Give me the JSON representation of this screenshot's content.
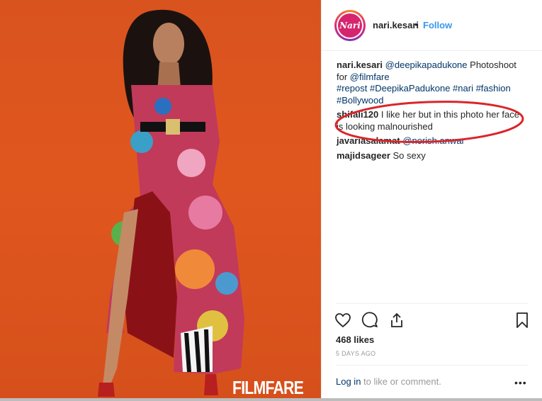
{
  "post": {
    "username": "nari.kesari",
    "avatar_text": "Nari",
    "dot": "•",
    "follow_label": "Follow",
    "watermark": "FILMFARE"
  },
  "caption": {
    "username": "nari.kesari",
    "mention": "@deepikapadukone",
    "text1": " Photoshoot for ",
    "mention2": "@filmfare",
    "hashtags": "#repost #DeepikaPadukone #nari #fashion #Bollywood"
  },
  "comments": [
    {
      "user": "shifali120",
      "text": "I like her but in this photo her face is looking malnourished"
    },
    {
      "user": "javariasalamat",
      "text": "@norish.anwar"
    },
    {
      "user": "majidsageer",
      "text": "So sexy"
    }
  ],
  "stats": {
    "likes": "468 likes",
    "timestamp": "5 DAYS AGO"
  },
  "footer": {
    "login_link": "Log in",
    "login_rest": " to like or comment.",
    "more": "•••"
  },
  "colors": {
    "link_blue": "#3897f0",
    "dark_link": "#003569",
    "annotation_red": "#d9262b",
    "photo_orange": "#d9531f"
  },
  "icons": [
    "heart-icon",
    "comment-icon",
    "share-icon",
    "bookmark-icon",
    "more-options-icon"
  ]
}
